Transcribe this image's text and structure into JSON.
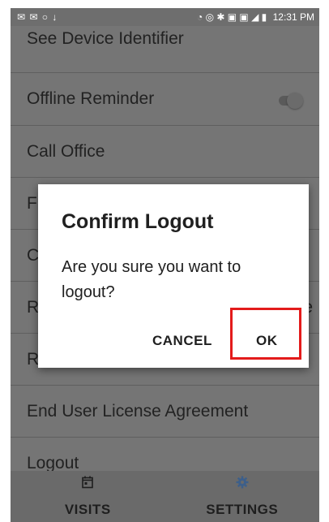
{
  "status_bar": {
    "left_icons": "✉ ✉ ○ ↓",
    "right_icons": "◔ ◎ ✱ ▣ ▣ ◢ ▮",
    "time": "12:31 PM"
  },
  "settings": {
    "items": [
      {
        "label": "See Device Identifier"
      },
      {
        "label": "Offline Reminder",
        "toggle": "off"
      },
      {
        "label": "Call Office"
      },
      {
        "label": "F"
      },
      {
        "label": "C"
      },
      {
        "label": "R",
        "trailing": "e"
      },
      {
        "label": "R"
      },
      {
        "label": "End User License Agreement"
      },
      {
        "label": "Logout"
      }
    ]
  },
  "dialog": {
    "title": "Confirm Logout",
    "message": "Are you sure you want to logout?",
    "cancel_label": "CANCEL",
    "ok_label": "OK"
  },
  "nav": {
    "tabs": [
      {
        "label": "VISITS",
        "icon": "calendar-icon",
        "active": false
      },
      {
        "label": "SETTINGS",
        "icon": "gear-icon",
        "active": true
      }
    ]
  },
  "colors": {
    "highlight": "#e31b1b",
    "active_icon": "#3d5f8a"
  }
}
